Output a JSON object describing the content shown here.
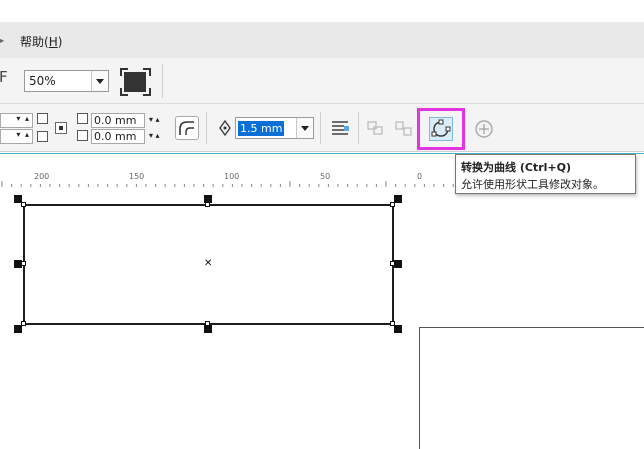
{
  "menu": {
    "help_label": "帮助(",
    "help_key": "H",
    "help_close": ")"
  },
  "toolbar": {
    "zoom_value": "50%"
  },
  "property_bar": {
    "corner_top": "0.0 mm",
    "corner_bottom": "0.0 mm",
    "outline_width": "1.5 mm"
  },
  "ruler": {
    "labels": [
      "200",
      "150",
      "100",
      "50",
      "0"
    ]
  },
  "tooltip": {
    "title": "转换为曲线 (Ctrl+Q)",
    "description": "允许使用形状工具修改对象。"
  },
  "colors": {
    "highlight_border": "#e234e0",
    "selection_blue": "#0a6fd6",
    "ruler_accent": "#4fb3c8"
  },
  "icons": [
    "chevron-right-icon",
    "fullscreen-icon",
    "lock-icon",
    "round-corner-icon",
    "pen-nib-icon",
    "text-wrap-icon",
    "combine-icon",
    "break-apart-icon",
    "convert-to-curves-icon",
    "add-circle-icon"
  ]
}
